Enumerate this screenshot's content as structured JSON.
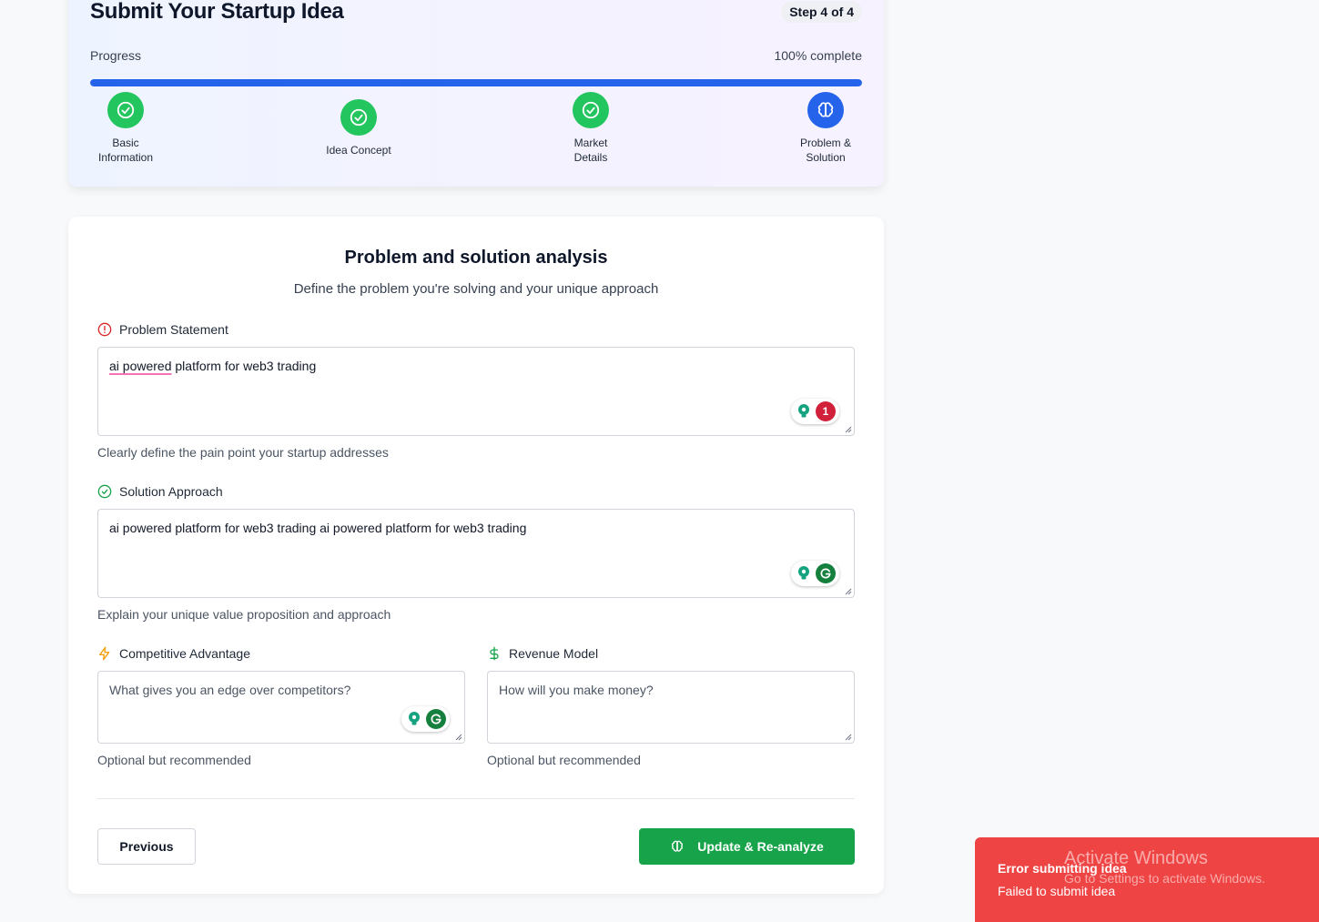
{
  "header": {
    "title": "Submit Your Startup Idea",
    "step_badge": "Step 4 of 4",
    "progress_label": "Progress",
    "progress_text": "100% complete",
    "progress_value": 1.0
  },
  "steps": [
    {
      "label_line1": "Basic",
      "label_line2": "Information",
      "status": "complete",
      "icon": "check-circle-icon"
    },
    {
      "label_line1": "Idea Concept",
      "label_line2": "",
      "status": "complete",
      "icon": "check-circle-icon"
    },
    {
      "label_line1": "Market",
      "label_line2": "Details",
      "status": "complete",
      "icon": "check-circle-icon"
    },
    {
      "label_line1": "Problem &",
      "label_line2": "Solution",
      "status": "active",
      "icon": "brain-icon"
    }
  ],
  "form": {
    "title": "Problem and solution analysis",
    "subtitle": "Define the problem you're solving and your unique approach",
    "problem": {
      "label": "Problem Statement",
      "value_underlined": "ai powered",
      "value_rest": " platform for web3 trading",
      "helper": "Clearly define the pain point your startup addresses",
      "grammar_count": "1"
    },
    "solution": {
      "label": "Solution Approach",
      "value": "ai powered platform for web3 trading ai powered platform for web3 trading",
      "helper": "Explain your unique value proposition and approach"
    },
    "advantage": {
      "label": "Competitive Advantage",
      "placeholder": "What gives you an edge over competitors?",
      "helper": "Optional but recommended"
    },
    "revenue": {
      "label": "Revenue Model",
      "placeholder": "How will you make money?",
      "helper": "Optional but recommended"
    },
    "buttons": {
      "previous": "Previous",
      "update": "Update & Re-analyze"
    }
  },
  "toast": {
    "title": "Error submitting idea",
    "message": "Failed to submit idea"
  },
  "watermark": {
    "title": "Activate Windows",
    "subtitle": "Go to Settings to activate Windows."
  },
  "colors": {
    "primary_blue": "#2563eb",
    "success_green": "#22c55e",
    "button_green": "#16a34a",
    "error_red": "#ef4444",
    "problem_icon_red": "#dc2626",
    "advantage_icon_amber": "#f59e0b"
  }
}
